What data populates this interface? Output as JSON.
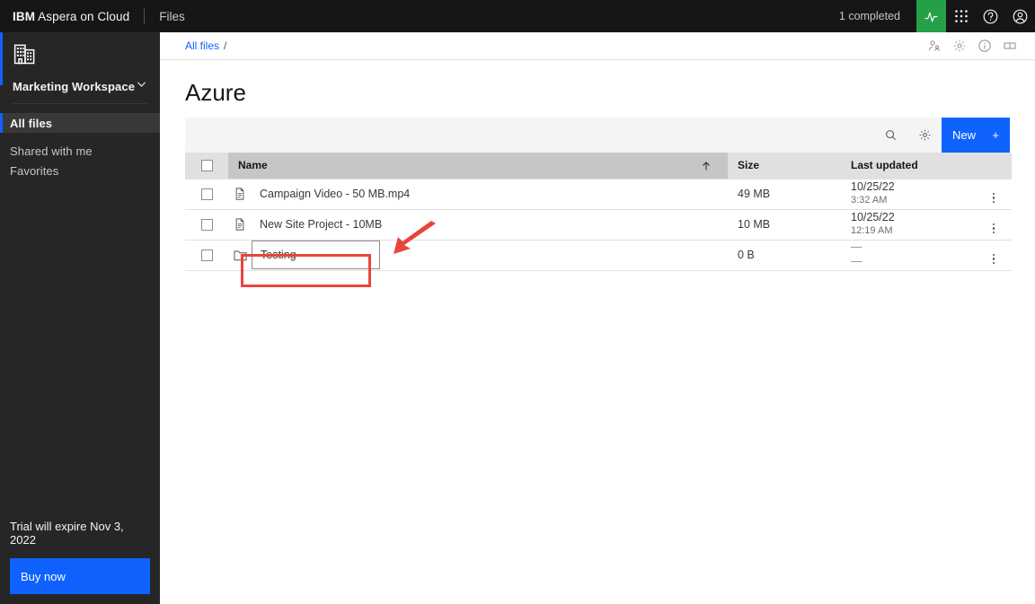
{
  "header": {
    "brand_bold": "IBM",
    "brand_rest": " Aspera on Cloud",
    "nav_files": "Files",
    "completed_status": "1 completed",
    "icons": {
      "activity": "activity-icon",
      "apps": "app-switcher-icon",
      "help": "help-icon",
      "account": "user-avatar-icon"
    },
    "accent_green": "#24a148",
    "background": "#161616"
  },
  "sidebar": {
    "workspace_icon": "enterprise-buildings-icon",
    "workspace_name": "Marketing Workspace",
    "workspace_chevron": "chevron-down-icon",
    "items": [
      {
        "label": "All files",
        "active": true
      },
      {
        "label": "Shared with me",
        "active": false
      },
      {
        "label": "Favorites",
        "active": false
      }
    ],
    "trial_text": "Trial will expire Nov 3, 2022",
    "buy_label": "Buy now",
    "accent_blue": "#0f62fe",
    "background": "#262626"
  },
  "breadcrumb": {
    "root_label": "All files",
    "separator": "/",
    "actions": [
      {
        "name": "share-members-icon",
        "title": "Members"
      },
      {
        "name": "gear-icon",
        "title": "Settings"
      },
      {
        "name": "info-icon",
        "title": "Information"
      },
      {
        "name": "panel-columns-icon",
        "title": "Panel"
      }
    ]
  },
  "page": {
    "title": "Azure"
  },
  "toolbar": {
    "search_icon": "search-icon",
    "settings_icon": "gear-icon",
    "new_label": "New",
    "new_plus": "+",
    "new_color": "#0f62fe"
  },
  "table": {
    "columns": {
      "name": "Name",
      "size": "Size",
      "last_updated": "Last updated"
    },
    "sort": {
      "column": "Name",
      "direction": "ascending",
      "glyph": "↑"
    },
    "select_all_checked": false,
    "rows": [
      {
        "icon": "document-icon",
        "name": "Campaign Video - 50 MB.mp4",
        "size": "49 MB",
        "date": "10/25/22",
        "time": "3:32 AM",
        "checked": false,
        "editing": false
      },
      {
        "icon": "document-icon",
        "name": "New Site Project - 10MB",
        "size": "10 MB",
        "date": "10/25/22",
        "time": "12:19 AM",
        "checked": false,
        "editing": false
      },
      {
        "icon": "folder-icon",
        "name": "Testing",
        "size": "0 B",
        "date": "—",
        "time": "—",
        "checked": false,
        "editing": true
      }
    ]
  },
  "annotations": {
    "highlight_color": "#e8453c",
    "target": "folder-rename-input"
  }
}
